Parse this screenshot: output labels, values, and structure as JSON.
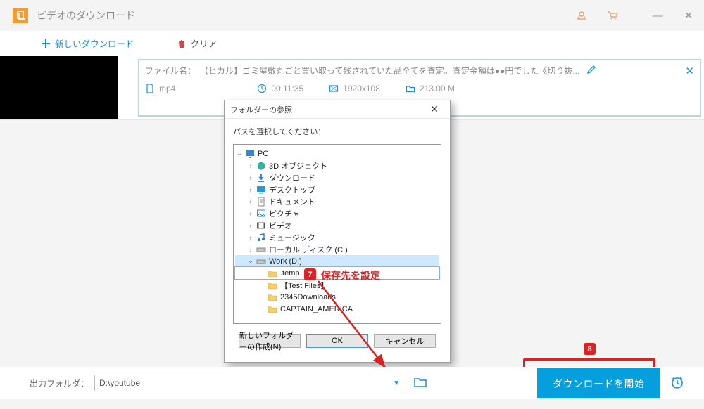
{
  "app": {
    "title": "ビデオのダウンロード"
  },
  "toolbar": {
    "new_download": "新しいダウンロード",
    "clear": "クリア"
  },
  "item": {
    "label": "ファイル名：",
    "filename": "【ヒカル】ゴミ屋敷丸ごと買い取って残されていた品全てを査定。査定金額は●●円でした《切り抜...",
    "format": "mp4",
    "duration": "00:11:35",
    "resolution": "1920x108",
    "size": "213.00 M"
  },
  "dialog": {
    "title": "フォルダーの参照",
    "prompt": "パスを選択してください：",
    "tree": [
      {
        "lvl": 0,
        "chev": "v",
        "name": "PC",
        "icon": "pc",
        "sel": false
      },
      {
        "lvl": 1,
        "chev": ">",
        "name": "3D オブジェクト",
        "icon": "3d"
      },
      {
        "lvl": 1,
        "chev": ">",
        "name": "ダウンロード",
        "icon": "dl"
      },
      {
        "lvl": 1,
        "chev": ">",
        "name": "デスクトップ",
        "icon": "desk"
      },
      {
        "lvl": 1,
        "chev": ">",
        "name": "ドキュメント",
        "icon": "doc"
      },
      {
        "lvl": 1,
        "chev": ">",
        "name": "ピクチャ",
        "icon": "pic"
      },
      {
        "lvl": 1,
        "chev": ">",
        "name": "ビデオ",
        "icon": "vid"
      },
      {
        "lvl": 1,
        "chev": ">",
        "name": "ミュージック",
        "icon": "mus"
      },
      {
        "lvl": 1,
        "chev": ">",
        "name": "ローカル ディスク (C:)",
        "icon": "drv"
      },
      {
        "lvl": 1,
        "chev": "v",
        "name": "Work (D:)",
        "icon": "drv",
        "sel": true
      },
      {
        "lvl": 2,
        "chev": " ",
        "name": ".temp",
        "icon": "fld",
        "box": true
      },
      {
        "lvl": 2,
        "chev": " ",
        "name": "【Test Files】",
        "icon": "fld"
      },
      {
        "lvl": 2,
        "chev": " ",
        "name": "2345Downloads",
        "icon": "fld"
      },
      {
        "lvl": 2,
        "chev": " ",
        "name": "CAPTAIN_AMERICA",
        "icon": "fld"
      }
    ],
    "new_folder": "新しいフォルダーの作成(N)",
    "ok": "OK",
    "cancel": "キャンセル"
  },
  "annotations": {
    "badge7": "7",
    "text7": "保存先を設定",
    "badge8": "8"
  },
  "bottom": {
    "out_label": "出力フォルダ：",
    "out_value": "D:\\youtube",
    "start": "ダウンロードを開始"
  }
}
